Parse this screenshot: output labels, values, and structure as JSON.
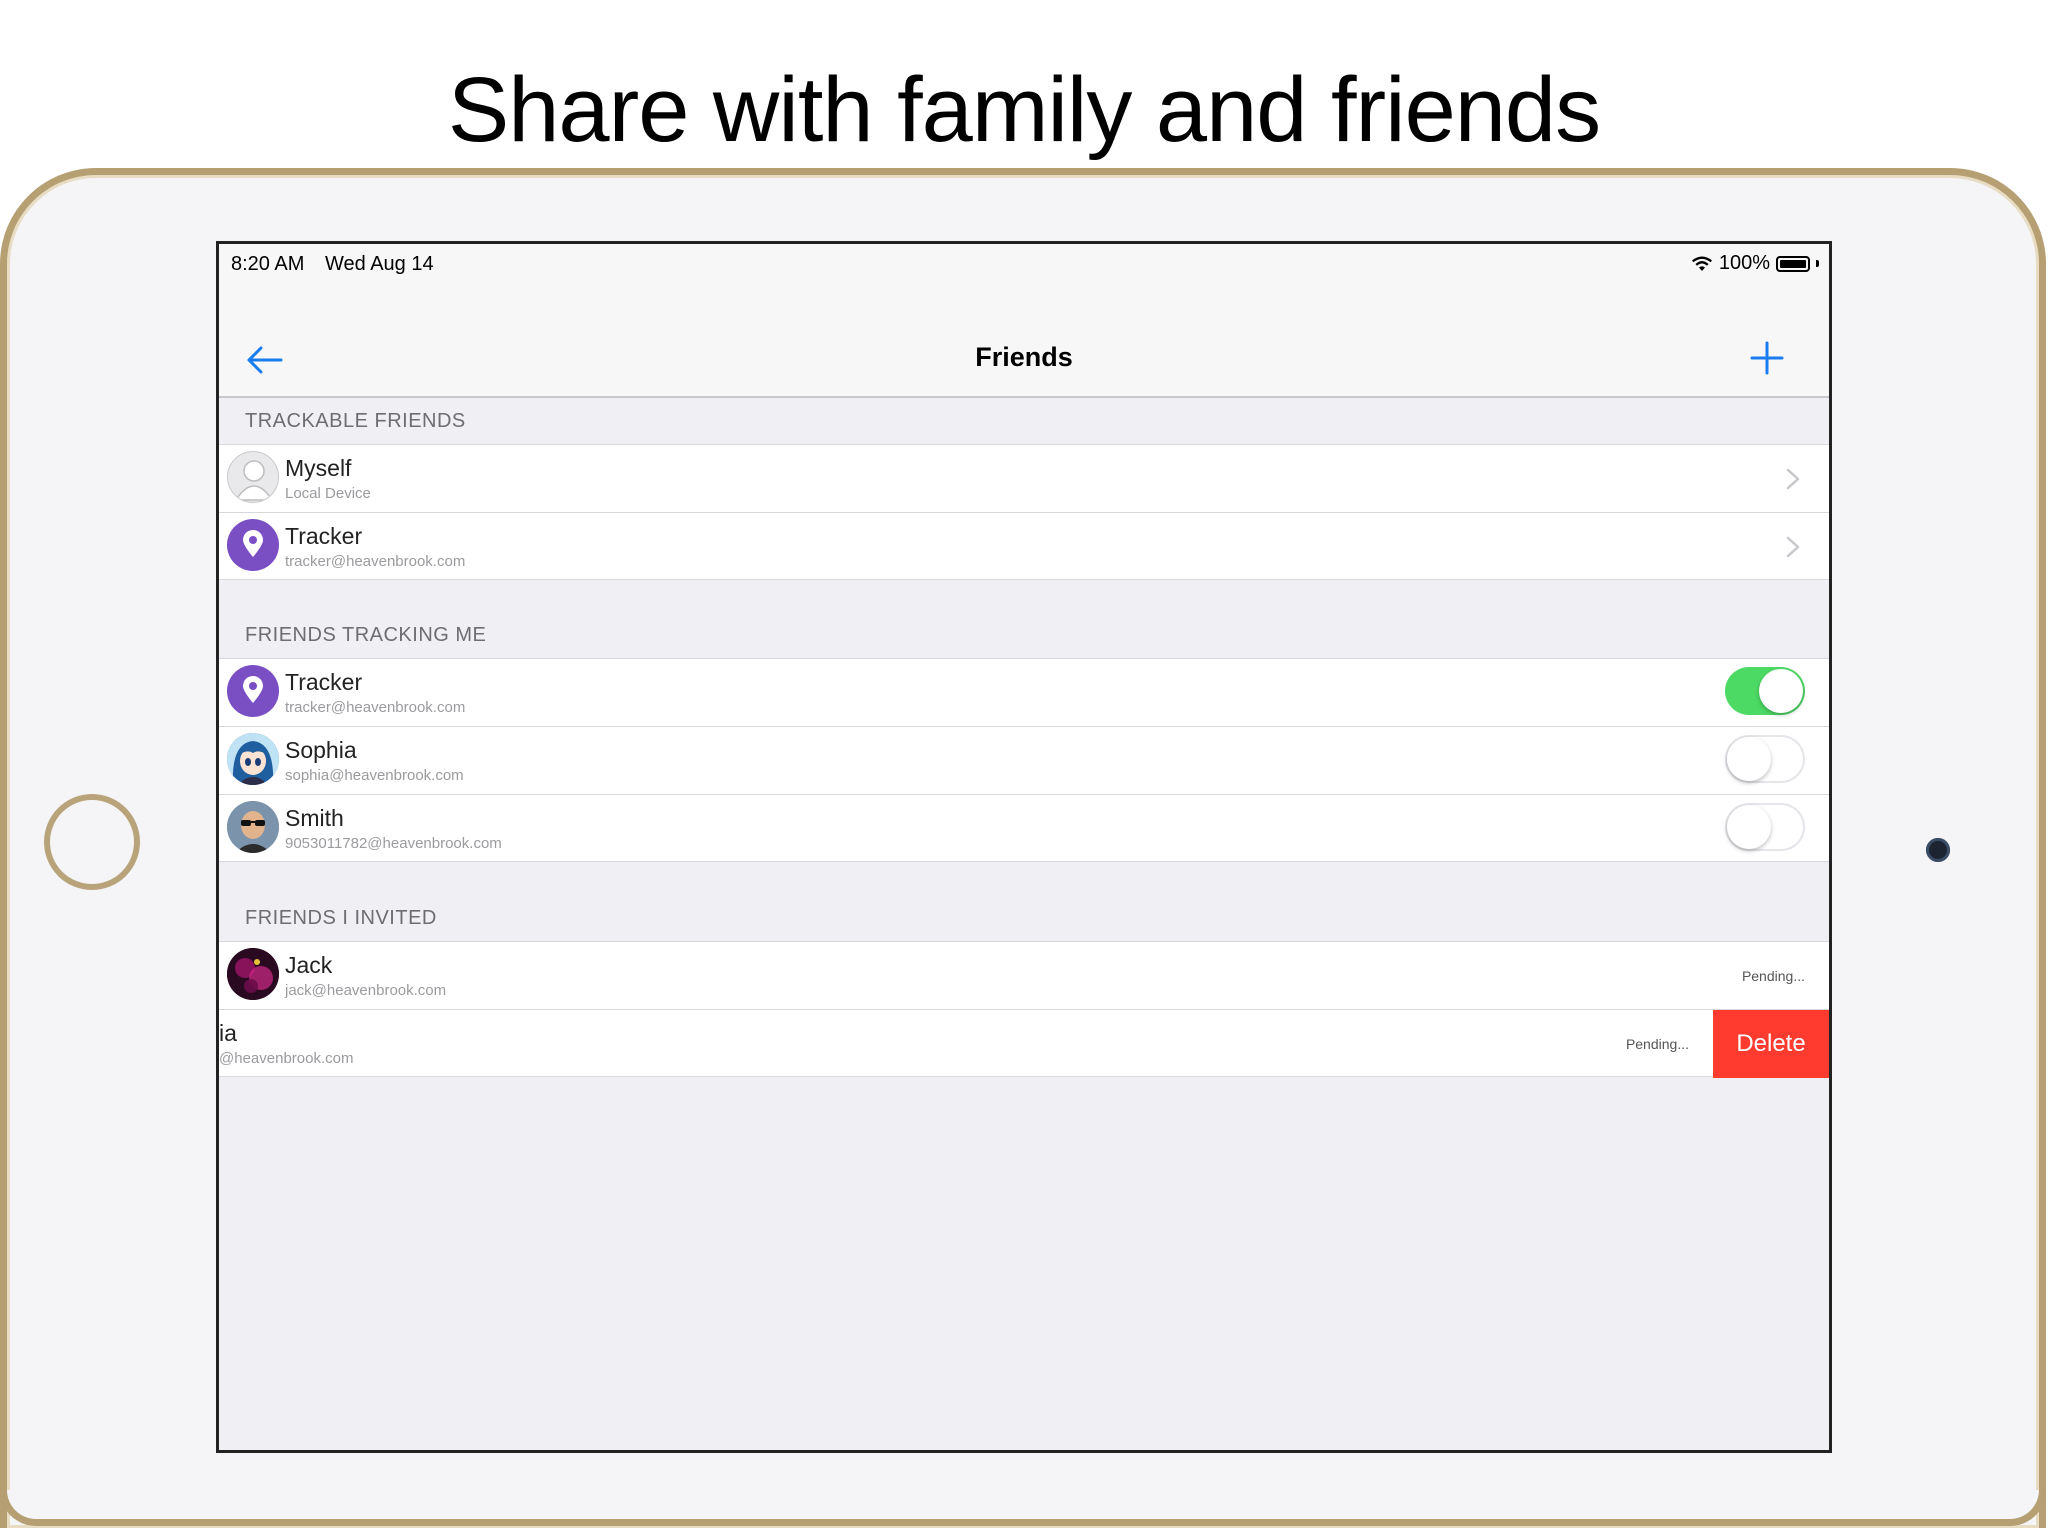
{
  "headline": "Share with family and friends",
  "status": {
    "time": "8:20 AM",
    "date": "Wed Aug 14",
    "battery": "100%"
  },
  "nav": {
    "title": "Friends",
    "back_icon": "arrow-left-icon",
    "add_icon": "plus-icon"
  },
  "sections": {
    "trackable": "TRACKABLE FRIENDS",
    "tracking_me": "FRIENDS TRACKING ME",
    "invited": "FRIENDS I INVITED"
  },
  "trackable": [
    {
      "name": "Myself",
      "sub": "Local Device"
    },
    {
      "name": "Tracker",
      "sub": "tracker@heavenbrook.com"
    }
  ],
  "tracking_me": [
    {
      "name": "Tracker",
      "sub": "tracker@heavenbrook.com",
      "enabled": true
    },
    {
      "name": "Sophia",
      "sub": "sophia@heavenbrook.com",
      "enabled": false
    },
    {
      "name": "Smith",
      "sub": "9053011782@heavenbrook.com",
      "enabled": false
    }
  ],
  "invited": [
    {
      "name": "Jack",
      "sub": "jack@heavenbrook.com",
      "status": "Pending..."
    },
    {
      "name": "ia",
      "sub": "@heavenbrook.com",
      "status": "Pending...",
      "action": "Delete"
    }
  ],
  "colors": {
    "accent": "#1a7cf0",
    "toggle_on": "#4cd964",
    "delete": "#ff3b30",
    "tracker_avatar": "#7b4fc4"
  }
}
